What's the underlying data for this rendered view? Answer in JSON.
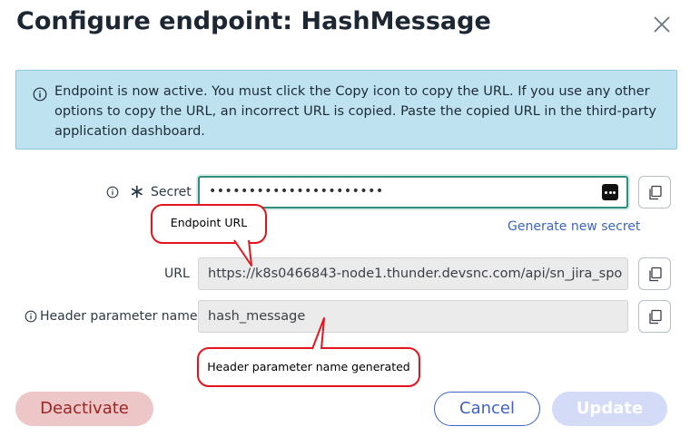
{
  "dialog": {
    "title": "Configure endpoint: HashMessage"
  },
  "banner": {
    "text": "Endpoint is now active. You must click the Copy icon to copy the URL. If you use any other options to copy the URL, an incorrect URL is copied. Paste the copied URL in the third-party application dashboard."
  },
  "fields": {
    "secret": {
      "label": "Secret",
      "value": "••••••••••••••••••••••"
    },
    "generate_link": "Generate new secret",
    "url": {
      "label": "URL",
      "value": "https://k8s0466843-node1.thunder.devsnc.com/api/sn_jira_spo"
    },
    "header_param": {
      "label": "Header parameter name",
      "value": "hash_message"
    }
  },
  "annotations": {
    "url_callout": "Endpoint URL",
    "header_callout": "Header parameter name generated"
  },
  "footer": {
    "deactivate": "Deactivate",
    "cancel": "Cancel",
    "update": "Update"
  },
  "colors": {
    "banner_bg": "#bfe2f1",
    "focus_border": "#2f8f7d",
    "link": "#3b66c4",
    "callout_border": "#e5141c",
    "deactivate_bg": "#edc7c7",
    "deactivate_text": "#9b2323",
    "primary_disabled": "#d3dbf7"
  },
  "icons": [
    "close-icon",
    "info-icon",
    "required-asterisk-icon",
    "reveal-password-icon",
    "copy-icon"
  ]
}
